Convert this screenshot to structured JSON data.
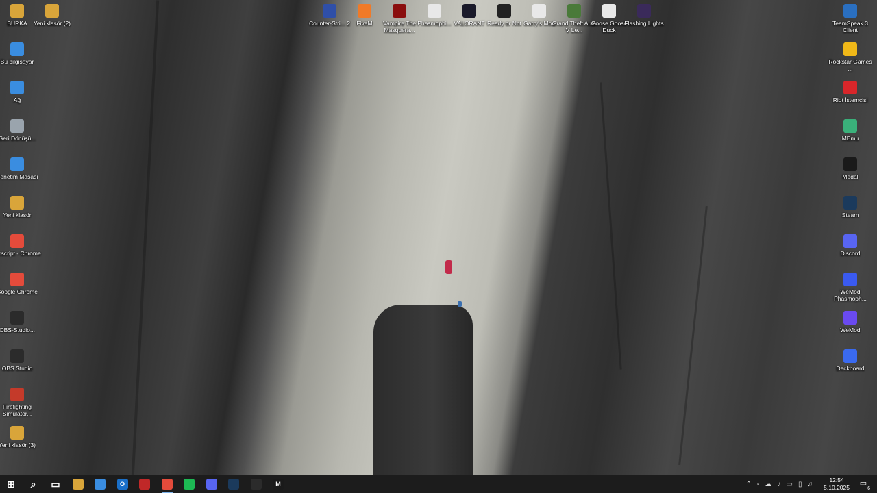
{
  "desktop": {
    "left_icons": [
      {
        "label": "BURKA",
        "icon": "folder-icon",
        "color": "#d9a53a"
      },
      {
        "label": "Yeni klasör (2)",
        "icon": "folder-icon",
        "color": "#d9a53a"
      },
      {
        "label": "Bu bilgisayar",
        "icon": "computer-icon",
        "color": "#3a8de0"
      },
      {
        "label": "Ağ",
        "icon": "network-icon",
        "color": "#3a8de0"
      },
      {
        "label": "Geri Dönüşü...",
        "icon": "recycle-bin-icon",
        "color": "#9aa4ad"
      },
      {
        "label": "Denetim Masası",
        "icon": "control-panel-icon",
        "color": "#3a8de0"
      },
      {
        "label": "Yeni klasör",
        "icon": "folder-icon",
        "color": "#d9a53a"
      },
      {
        "label": "ilarscript - Chrome",
        "icon": "chrome-icon",
        "color": "#e44b3b"
      },
      {
        "label": "Google Chrome",
        "icon": "chrome-icon",
        "color": "#e44b3b"
      },
      {
        "label": "OBS-Studio...",
        "icon": "obs-icon",
        "color": "#2b2b2b"
      },
      {
        "label": "OBS Studio",
        "icon": "obs-icon",
        "color": "#2b2b2b"
      },
      {
        "label": "Firefighting Simulator...",
        "icon": "game-icon",
        "color": "#c43a2a"
      },
      {
        "label": "Yeni klasör (3)",
        "icon": "folder-icon",
        "color": "#d9a53a"
      }
    ],
    "top_icons": [
      {
        "label": "Counter-Stri... 2",
        "icon": "cs2-icon",
        "color": "#2f4fa8"
      },
      {
        "label": "FiveM",
        "icon": "fivem-icon",
        "color": "#f07a28"
      },
      {
        "label": "Vampire The Masquera...",
        "icon": "vampire-icon",
        "color": "#8a0e0e"
      },
      {
        "label": "Phasmophi...",
        "icon": "file-icon",
        "color": "#e8e8e8"
      },
      {
        "label": "VALORANT",
        "icon": "valorant-icon",
        "color": "#1a1a2a"
      },
      {
        "label": "Ready or Not",
        "icon": "ready-or-not-icon",
        "color": "#222222"
      },
      {
        "label": "Garry's Mod",
        "icon": "file-icon",
        "color": "#e8e8e8"
      },
      {
        "label": "Grand Theft Auto V Le...",
        "icon": "gta-icon",
        "color": "#4a7a3a"
      },
      {
        "label": "Goose Goose Duck",
        "icon": "goose-icon",
        "color": "#e8e8e8"
      },
      {
        "label": "Flashing Lights",
        "icon": "flashing-lights-icon",
        "color": "#3a2a5a"
      }
    ],
    "right_icons": [
      {
        "label": "TeamSpeak 3 Client",
        "icon": "teamspeak-icon",
        "color": "#2a6fc0"
      },
      {
        "label": "Rockstar Games ...",
        "icon": "rockstar-icon",
        "color": "#f0b818"
      },
      {
        "label": "Riot İstemcisi",
        "icon": "riot-icon",
        "color": "#d8262a"
      },
      {
        "label": "MEmu",
        "icon": "memu-icon",
        "color": "#3ab07a"
      },
      {
        "label": "Medal",
        "icon": "medal-icon",
        "color": "#1a1a1a"
      },
      {
        "label": "Steam",
        "icon": "steam-icon",
        "color": "#1b3a5c"
      },
      {
        "label": "Discord",
        "icon": "discord-icon",
        "color": "#5865f2"
      },
      {
        "label": "WeMod Phasmoph...",
        "icon": "wemod-icon",
        "color": "#3a5af0"
      },
      {
        "label": "WeMod",
        "icon": "wemod-icon",
        "color": "#6a4af0"
      },
      {
        "label": "Deckboard",
        "icon": "deckboard-icon",
        "color": "#3a6af0"
      }
    ]
  },
  "taskbar": {
    "items": [
      {
        "name": "start-button",
        "icon": "windows-icon",
        "color": "#ffffff",
        "glyph": "⊞"
      },
      {
        "name": "search-button",
        "icon": "search-icon",
        "color": "#ffffff",
        "glyph": "⌕"
      },
      {
        "name": "task-view-button",
        "icon": "task-view-icon",
        "color": "#ffffff",
        "glyph": "▭"
      },
      {
        "name": "file-explorer-button",
        "icon": "folder-icon",
        "color": "#d9a53a",
        "glyph": ""
      },
      {
        "name": "store-button",
        "icon": "store-icon",
        "color": "#3a8de0",
        "glyph": ""
      },
      {
        "name": "outlook-button",
        "icon": "outlook-icon",
        "color": "#1a6fc8",
        "glyph": "O"
      },
      {
        "name": "wallpaper-app-button",
        "icon": "app-icon",
        "color": "#c02828",
        "glyph": ""
      },
      {
        "name": "chrome-button",
        "icon": "chrome-icon",
        "color": "#e44b3b",
        "glyph": "",
        "active": true
      },
      {
        "name": "spotify-button",
        "icon": "spotify-icon",
        "color": "#1db954",
        "glyph": ""
      },
      {
        "name": "discord-button",
        "icon": "discord-icon",
        "color": "#5865f2",
        "glyph": ""
      },
      {
        "name": "steam-button",
        "icon": "steam-icon",
        "color": "#1b3a5c",
        "glyph": ""
      },
      {
        "name": "obs-button",
        "icon": "obs-icon",
        "color": "#2b2b2b",
        "glyph": ""
      },
      {
        "name": "medal-button",
        "icon": "medal-icon",
        "color": "#1a1a1a",
        "glyph": "M"
      }
    ],
    "tray_icons": [
      "chevron-up-icon",
      "app-tray-icon",
      "cloud-icon",
      "microphone-icon",
      "monitor-icon",
      "network-icon",
      "speaker-icon"
    ],
    "time": "12:54",
    "date": "5.10.2025",
    "notification_count": "6"
  }
}
